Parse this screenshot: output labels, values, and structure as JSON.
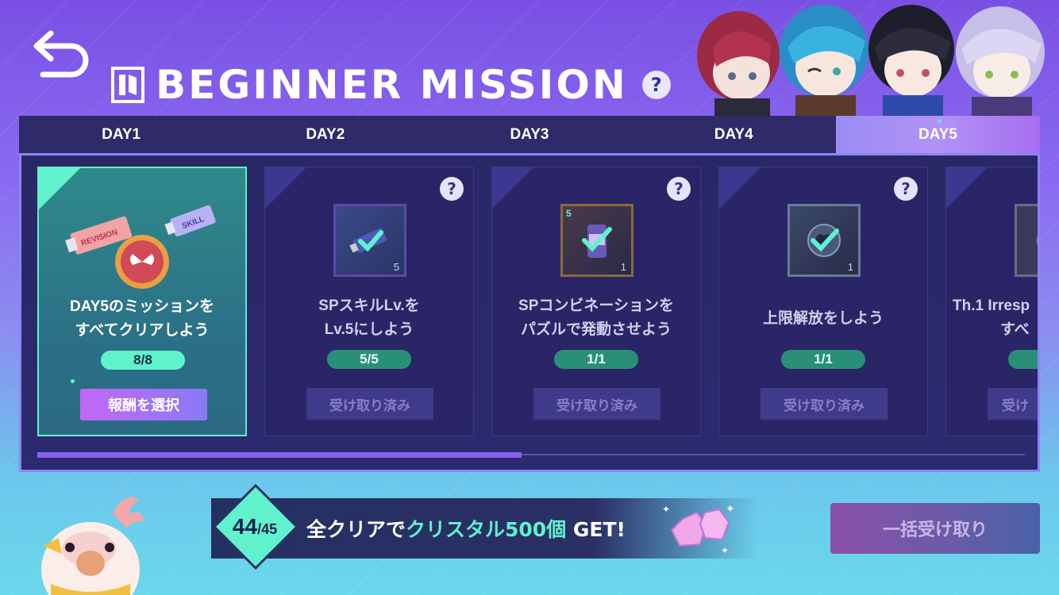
{
  "header": {
    "title": "BEGINNER MISSION",
    "help_label": "?"
  },
  "tabs": [
    {
      "label": "DAY1",
      "active": false
    },
    {
      "label": "DAY2",
      "active": false
    },
    {
      "label": "DAY3",
      "active": false
    },
    {
      "label": "DAY4",
      "active": false
    },
    {
      "label": "DAY5",
      "active": true
    }
  ],
  "missions": [
    {
      "line1": "DAY5のミッションを",
      "line2": "すべてクリアしよう",
      "progress": "8/8",
      "button": "報酬を選択",
      "state": "selectable"
    },
    {
      "line1": "SPスキルLv.を",
      "line2": "Lv.5にしよう",
      "progress": "5/5",
      "button": "受け取り済み",
      "item_count": "5",
      "state": "claimed"
    },
    {
      "line1": "SPコンビネーションを",
      "line2": "パズルで発動させよう",
      "progress": "1/1",
      "button": "受け取り済み",
      "item_count": "1",
      "item_badge": "5",
      "state": "claimed"
    },
    {
      "line1": "上限解放をしよう",
      "line2": "",
      "progress": "1/1",
      "button": "受け取り済み",
      "item_count": "1",
      "state": "claimed"
    },
    {
      "line1": "Th.1 Irresp",
      "line2": "すべ",
      "progress": "",
      "button": "受け",
      "state": "claimed"
    }
  ],
  "item_labels": {
    "revision": "REVISION",
    "skill": "SKILL"
  },
  "footer": {
    "cleared": "44",
    "total": "/45",
    "text_before": "全クリアで",
    "highlight": "クリスタル500個",
    "text_after": " GET!",
    "bulk_button": "一括受け取り"
  },
  "scroll_progress": 0.49,
  "colors": {
    "accent": "#5ff2cc",
    "panel": "#2a2766",
    "select_button": "#c168f6"
  }
}
